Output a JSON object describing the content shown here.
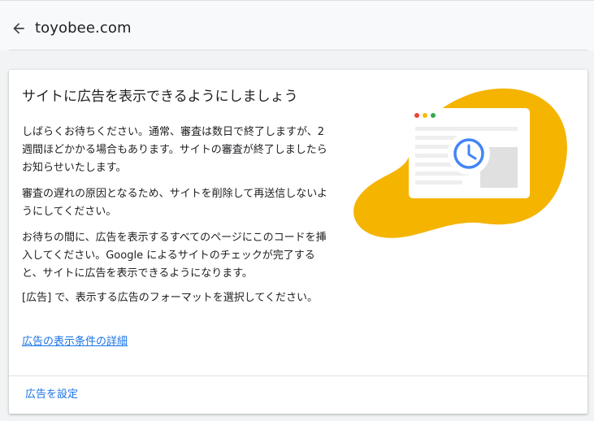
{
  "header": {
    "site": "toyobee.com",
    "back_icon": "arrow-back-icon"
  },
  "card": {
    "title": "サイトに広告を表示できるようにしましょう",
    "paragraphs": [
      "しばらくお待ちください。通常、審査は数日で終了しますが、2 週間ほどかかる場合もあります。サイトの審査が終了しましたらお知らせいたします。",
      "審査の遅れの原因となるため、サイトを削除して再送信しないようにしてください。",
      "お待ちの間に、広告を表示するすべてのページにこのコードを挿入してください。Google によるサイトのチェックが完了すると、サイトに広告を表示できるようになります。",
      "[広告] で、表示する広告のフォーマットを選択してください。"
    ],
    "details_link": "広告の表示条件の詳細",
    "setup_button": "広告を設定"
  },
  "colors": {
    "accent": "#1a73e8",
    "blob": "#f4b400",
    "clock": "#4285f4",
    "dot_red": "#ea4335",
    "dot_yellow": "#fbbc04",
    "dot_green": "#34a853"
  }
}
